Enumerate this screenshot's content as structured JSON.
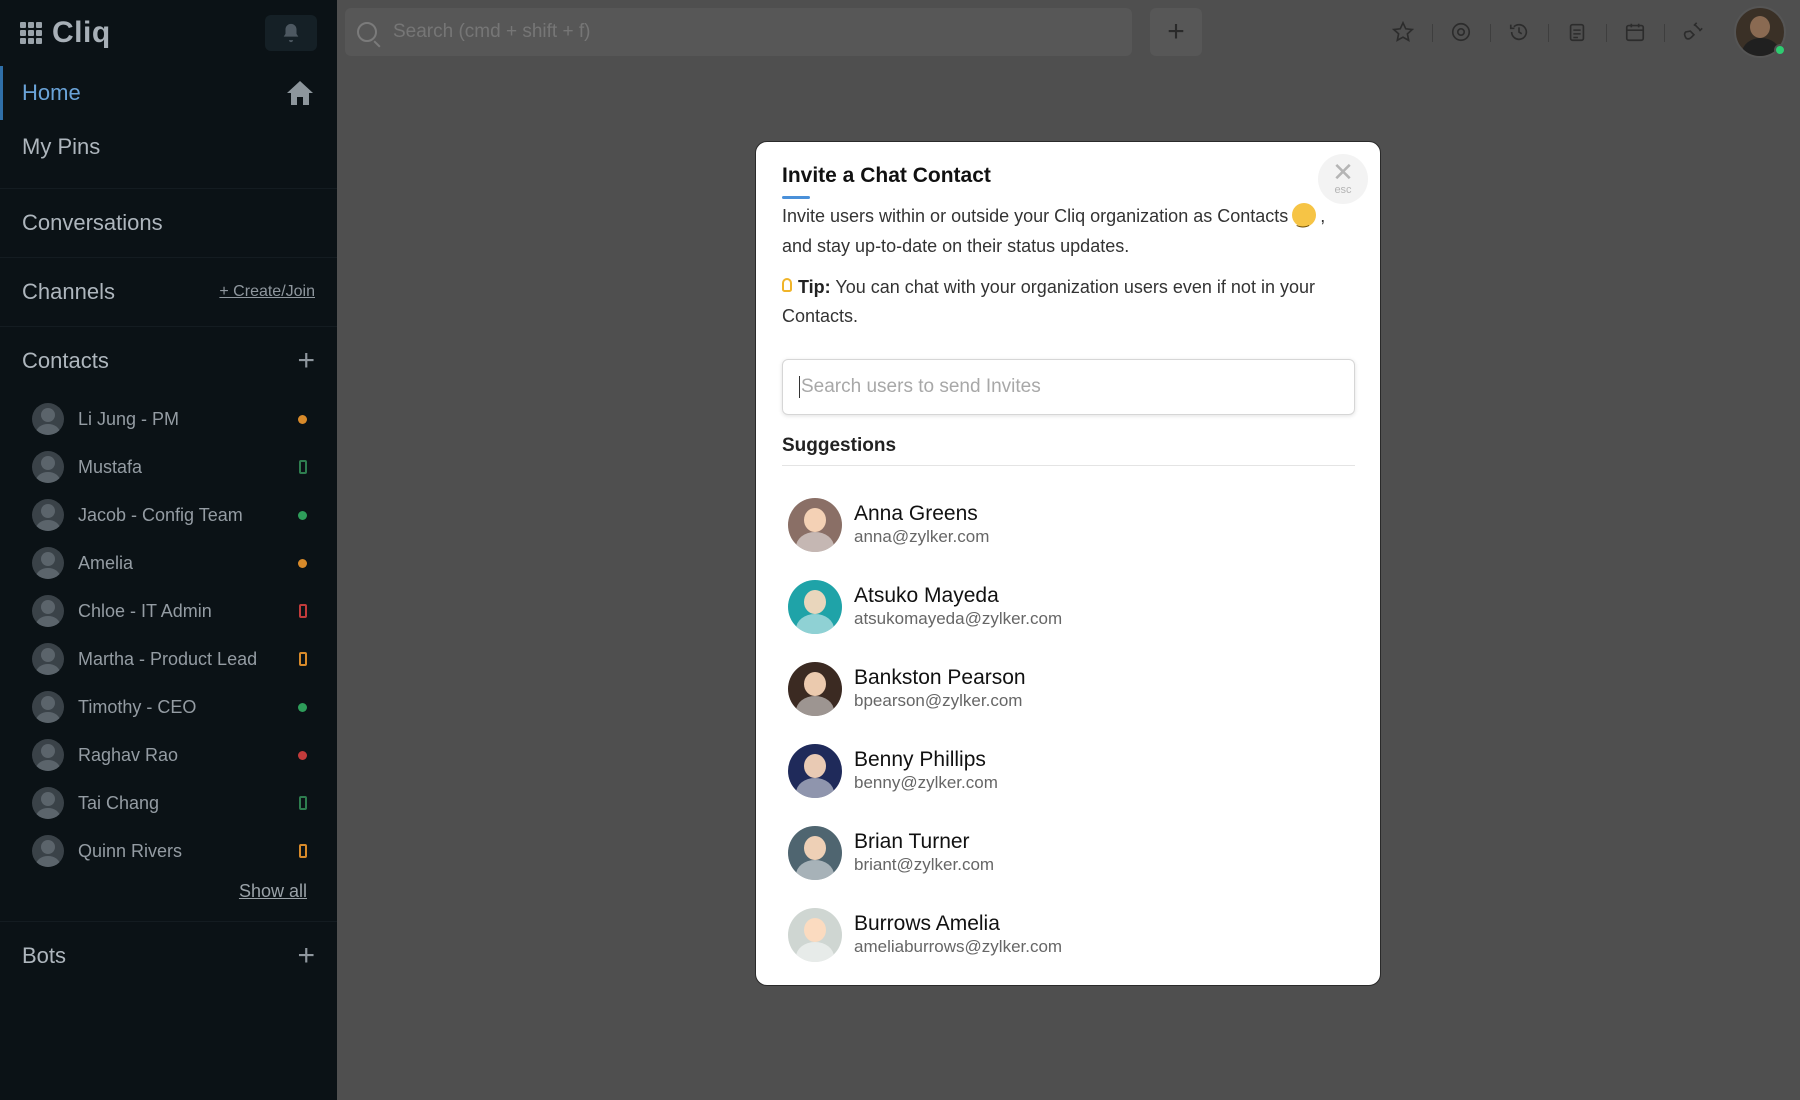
{
  "app": {
    "name": "Cliq"
  },
  "nav": {
    "home": "Home",
    "my_pins": "My Pins",
    "conversations": "Conversations",
    "channels": "Channels",
    "channels_action": "+ Create/Join",
    "contacts": "Contacts",
    "bots": "Bots",
    "show_all": "Show all"
  },
  "contacts": [
    {
      "name": "Li Jung - PM",
      "status": "away",
      "status_color": "#d88a2a"
    },
    {
      "name": "Mustafa",
      "status": "mobile",
      "status_color": "#2e7d4f"
    },
    {
      "name": "Jacob - Config Team",
      "status": "online",
      "status_color": "#2e9d5a"
    },
    {
      "name": "Amelia",
      "status": "away",
      "status_color": "#d88a2a"
    },
    {
      "name": "Chloe - IT Admin",
      "status": "mobile-busy",
      "status_color": "#c23b3b"
    },
    {
      "name": "Martha -  Product Lead",
      "status": "mobile-away",
      "status_color": "#d88a2a"
    },
    {
      "name": "Timothy - CEO",
      "status": "online",
      "status_color": "#2e9d5a"
    },
    {
      "name": "Raghav Rao",
      "status": "busy",
      "status_color": "#c23b3b"
    },
    {
      "name": "Tai Chang",
      "status": "mobile",
      "status_color": "#2e7d4f"
    },
    {
      "name": "Quinn Rivers",
      "status": "mobile-away",
      "status_color": "#d88a2a"
    }
  ],
  "topbar": {
    "search_placeholder": "Search (cmd + shift + f)",
    "icons": [
      "star-icon",
      "mention-icon",
      "history-icon",
      "clipboard-icon",
      "calendar-icon",
      "plug-icon"
    ]
  },
  "modal": {
    "title": "Invite a Chat Contact",
    "close_hint": "esc",
    "description_part1": "Invite users within or outside your Cliq organization as Contacts",
    "description_part2": ", and stay up-to-date on their status updates.",
    "tip_label": "Tip:",
    "tip_text": " You can chat with your organization users even if not in your Contacts.",
    "input_placeholder": "Search users to send Invites",
    "suggestions_title": "Suggestions",
    "suggestions": [
      {
        "name": "Anna Greens",
        "email": "anna@zylker.com",
        "avatar_color": "#8a6f66"
      },
      {
        "name": "Atsuko Mayeda",
        "email": "atsukomayeda@zylker.com",
        "avatar_color": "#1fa3a8"
      },
      {
        "name": "Bankston Pearson",
        "email": "bpearson@zylker.com",
        "avatar_color": "#3b2a22"
      },
      {
        "name": "Benny Phillips",
        "email": "benny@zylker.com",
        "avatar_color": "#1f2a5a"
      },
      {
        "name": "Brian Turner",
        "email": "briant@zylker.com",
        "avatar_color": "#4f6570"
      },
      {
        "name": "Burrows Amelia",
        "email": "ameliaburrows@zylker.com",
        "avatar_color": "#cfd6d2"
      }
    ]
  }
}
